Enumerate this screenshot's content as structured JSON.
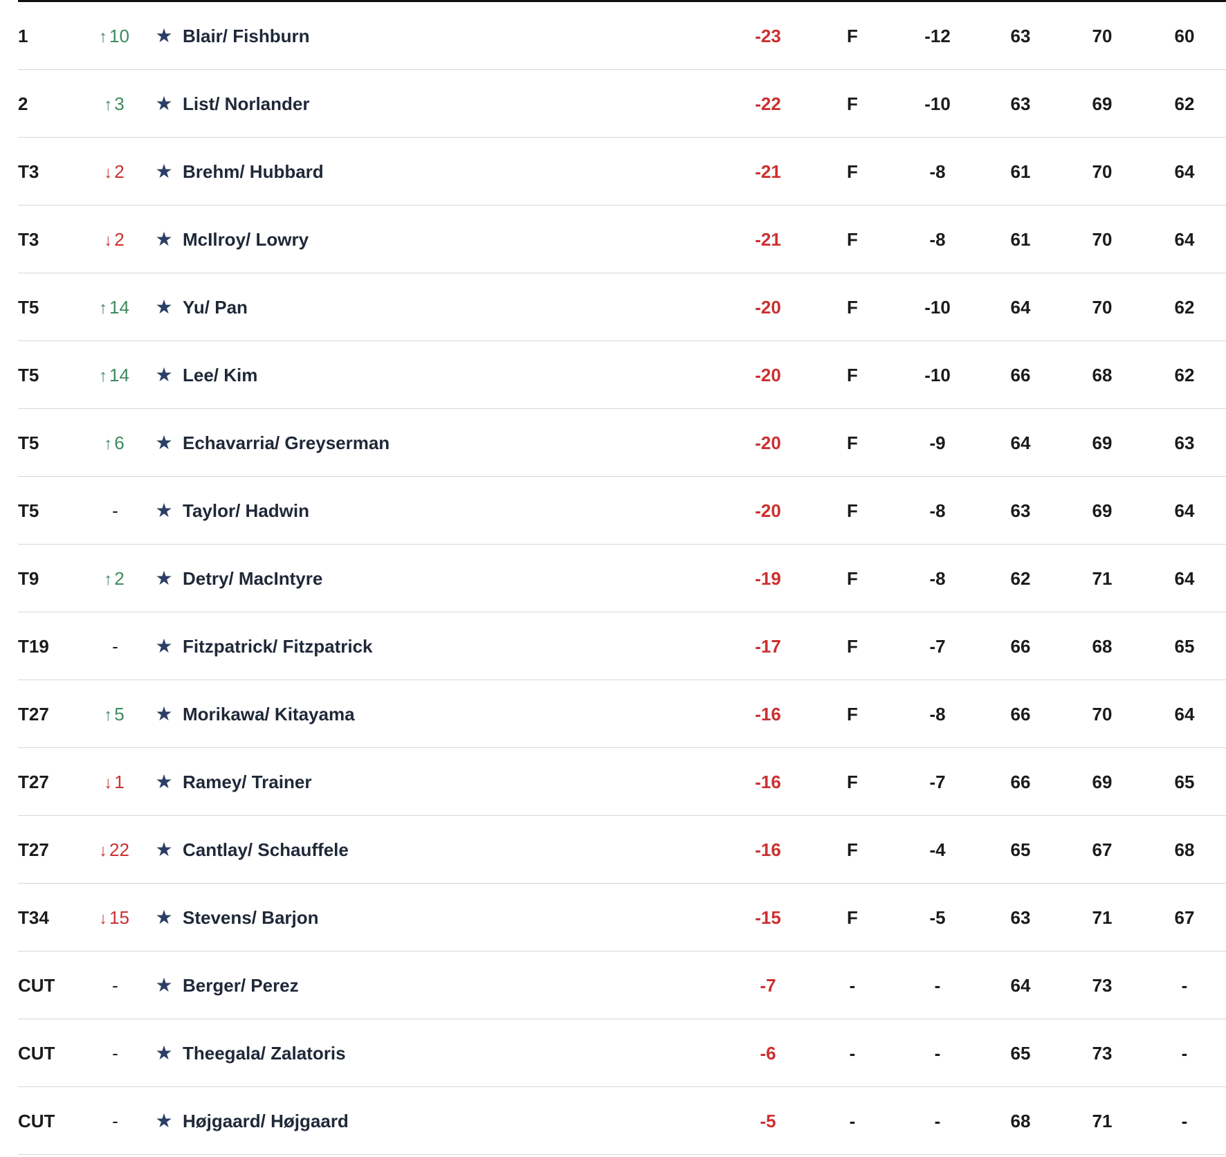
{
  "leaderboard": {
    "rows": [
      {
        "pos": "1",
        "move_dir": "up",
        "move_arrow": "↑",
        "move": "10",
        "favorite_icon": "★",
        "player": "Blair/ Fishburn",
        "total": "-23",
        "thru": "F",
        "today": "-12",
        "r1": "63",
        "r2": "70",
        "r3": "60"
      },
      {
        "pos": "2",
        "move_dir": "up",
        "move_arrow": "↑",
        "move": "3",
        "favorite_icon": "★",
        "player": "List/ Norlander",
        "total": "-22",
        "thru": "F",
        "today": "-10",
        "r1": "63",
        "r2": "69",
        "r3": "62"
      },
      {
        "pos": "T3",
        "move_dir": "down",
        "move_arrow": "↓",
        "move": "2",
        "favorite_icon": "★",
        "player": "Brehm/ Hubbard",
        "total": "-21",
        "thru": "F",
        "today": "-8",
        "r1": "61",
        "r2": "70",
        "r3": "64"
      },
      {
        "pos": "T3",
        "move_dir": "down",
        "move_arrow": "↓",
        "move": "2",
        "favorite_icon": "★",
        "player": "McIlroy/ Lowry",
        "total": "-21",
        "thru": "F",
        "today": "-8",
        "r1": "61",
        "r2": "70",
        "r3": "64"
      },
      {
        "pos": "T5",
        "move_dir": "up",
        "move_arrow": "↑",
        "move": "14",
        "favorite_icon": "★",
        "player": "Yu/ Pan",
        "total": "-20",
        "thru": "F",
        "today": "-10",
        "r1": "64",
        "r2": "70",
        "r3": "62"
      },
      {
        "pos": "T5",
        "move_dir": "up",
        "move_arrow": "↑",
        "move": "14",
        "favorite_icon": "★",
        "player": "Lee/ Kim",
        "total": "-20",
        "thru": "F",
        "today": "-10",
        "r1": "66",
        "r2": "68",
        "r3": "62"
      },
      {
        "pos": "T5",
        "move_dir": "up",
        "move_arrow": "↑",
        "move": "6",
        "favorite_icon": "★",
        "player": "Echavarria/ Greyserman",
        "total": "-20",
        "thru": "F",
        "today": "-9",
        "r1": "64",
        "r2": "69",
        "r3": "63"
      },
      {
        "pos": "T5",
        "move_dir": "none",
        "move_arrow": "",
        "move": "-",
        "favorite_icon": "★",
        "player": "Taylor/ Hadwin",
        "total": "-20",
        "thru": "F",
        "today": "-8",
        "r1": "63",
        "r2": "69",
        "r3": "64"
      },
      {
        "pos": "T9",
        "move_dir": "up",
        "move_arrow": "↑",
        "move": "2",
        "favorite_icon": "★",
        "player": "Detry/ MacIntyre",
        "total": "-19",
        "thru": "F",
        "today": "-8",
        "r1": "62",
        "r2": "71",
        "r3": "64"
      },
      {
        "pos": "T19",
        "move_dir": "none",
        "move_arrow": "",
        "move": "-",
        "favorite_icon": "★",
        "player": "Fitzpatrick/ Fitzpatrick",
        "total": "-17",
        "thru": "F",
        "today": "-7",
        "r1": "66",
        "r2": "68",
        "r3": "65"
      },
      {
        "pos": "T27",
        "move_dir": "up",
        "move_arrow": "↑",
        "move": "5",
        "favorite_icon": "★",
        "player": "Morikawa/ Kitayama",
        "total": "-16",
        "thru": "F",
        "today": "-8",
        "r1": "66",
        "r2": "70",
        "r3": "64"
      },
      {
        "pos": "T27",
        "move_dir": "down",
        "move_arrow": "↓",
        "move": "1",
        "favorite_icon": "★",
        "player": "Ramey/ Trainer",
        "total": "-16",
        "thru": "F",
        "today": "-7",
        "r1": "66",
        "r2": "69",
        "r3": "65"
      },
      {
        "pos": "T27",
        "move_dir": "down",
        "move_arrow": "↓",
        "move": "22",
        "favorite_icon": "★",
        "player": "Cantlay/ Schauffele",
        "total": "-16",
        "thru": "F",
        "today": "-4",
        "r1": "65",
        "r2": "67",
        "r3": "68"
      },
      {
        "pos": "T34",
        "move_dir": "down",
        "move_arrow": "↓",
        "move": "15",
        "favorite_icon": "★",
        "player": "Stevens/ Barjon",
        "total": "-15",
        "thru": "F",
        "today": "-5",
        "r1": "63",
        "r2": "71",
        "r3": "67"
      },
      {
        "pos": "CUT",
        "move_dir": "none",
        "move_arrow": "",
        "move": "-",
        "favorite_icon": "★",
        "player": "Berger/ Perez",
        "total": "-7",
        "thru": "-",
        "today": "-",
        "r1": "64",
        "r2": "73",
        "r3": "-"
      },
      {
        "pos": "CUT",
        "move_dir": "none",
        "move_arrow": "",
        "move": "-",
        "favorite_icon": "★",
        "player": "Theegala/ Zalatoris",
        "total": "-6",
        "thru": "-",
        "today": "-",
        "r1": "65",
        "r2": "73",
        "r3": "-"
      },
      {
        "pos": "CUT",
        "move_dir": "none",
        "move_arrow": "",
        "move": "-",
        "favorite_icon": "★",
        "player": "Højgaard/ Højgaard",
        "total": "-5",
        "thru": "-",
        "today": "-",
        "r1": "68",
        "r2": "71",
        "r3": "-"
      }
    ]
  },
  "colors": {
    "under_par": "#cc3030",
    "move_up": "#3d8a5f",
    "move_down": "#cc3030",
    "star": "#2b3e66",
    "row_divider": "#d6d6d6"
  }
}
